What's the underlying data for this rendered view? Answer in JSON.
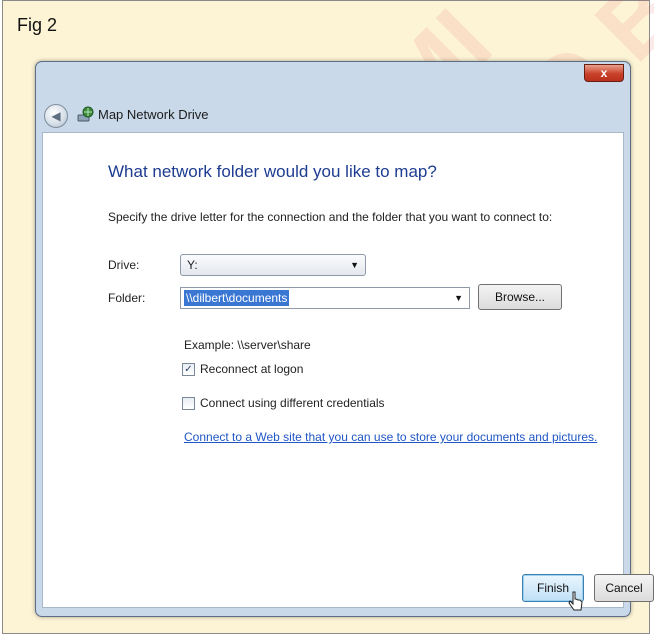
{
  "figure_label": "Fig 2",
  "watermark": {
    "line1": "© NIMI",
    "line2": "NOT TO BE"
  },
  "window": {
    "title": "Map Network Drive",
    "close_label": "x"
  },
  "dialog": {
    "heading": "What network folder would you like to map?",
    "instruction": "Specify the drive letter for the connection and the folder that you want to connect to:",
    "drive_label": "Drive:",
    "drive_value": "Y:",
    "folder_label": "Folder:",
    "folder_value": "\\\\dilbert\\documents",
    "browse_label": "Browse...",
    "example": "Example: \\\\server\\share",
    "reconnect_label": "Reconnect at logon",
    "reconnect_checked": true,
    "credentials_label": "Connect using different credentials",
    "credentials_checked": false,
    "web_link": "Connect to a Web site that you can use to store your documents and pictures."
  },
  "buttons": {
    "finish": "Finish",
    "cancel": "Cancel"
  }
}
